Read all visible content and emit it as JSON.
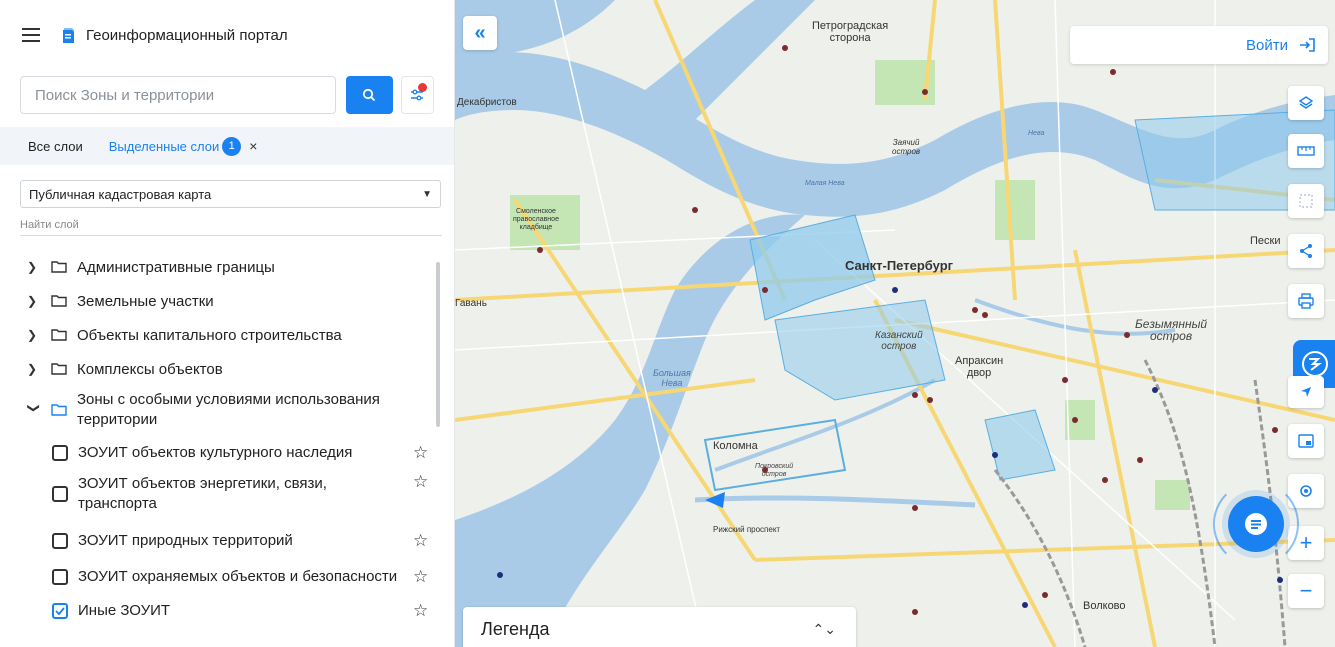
{
  "app": {
    "title": "Геоинформационный портал"
  },
  "search": {
    "placeholder": "Поиск Зоны и территории"
  },
  "tabs": {
    "all_label": "Все слои",
    "selected_label": "Выделенные слои",
    "selected_count": "1",
    "close": "×"
  },
  "basemap_select": {
    "value": "Публичная кадастровая карта"
  },
  "layer_search": {
    "placeholder": "Найти слой"
  },
  "tree": {
    "groups": [
      {
        "label": "Административные границы",
        "expanded": false
      },
      {
        "label": "Земельные участки",
        "expanded": false
      },
      {
        "label": "Объекты капитального строительства",
        "expanded": false
      },
      {
        "label": "Комплексы объектов",
        "expanded": false
      },
      {
        "label": "Зоны с особыми условиями использования территории",
        "expanded": true
      }
    ],
    "children": [
      {
        "label": "ЗОУИТ объектов культурного наследия",
        "checked": false
      },
      {
        "label": "ЗОУИТ объектов энергетики, связи, транспорта",
        "checked": false
      },
      {
        "label": "ЗОУИТ природных территорий",
        "checked": false
      },
      {
        "label": "ЗОУИТ охраняемых объектов и безопасности",
        "checked": false
      },
      {
        "label": "Иные ЗОУИТ",
        "checked": true
      }
    ]
  },
  "map": {
    "login_label": "Войти",
    "legend_label": "Легенда",
    "labels": {
      "petrogradskaya": "Петроградская\nсторона",
      "dekabristov": "Декабристов",
      "zayachiy": "Заячий\nостров",
      "smolenskoe": "Смоленское\nправославное\nкладбище",
      "spb": "Санкт-Петербург",
      "gavan": "Гавань",
      "kazansky": "Казанский\nостров",
      "apraksin": "Апраксин\nдвор",
      "bezymyanny": "Безымянный\nостров",
      "peski": "Пески",
      "bolshaya_neva": "Большая\nНева",
      "kolomna": "Коломна",
      "pokrovsky": "Покровский\nостров",
      "rizhsky": "Рижский проспект",
      "volkovo": "Волково",
      "malaya_neva": "Малая Нева",
      "neva": "Нева"
    }
  },
  "colors": {
    "accent": "#1a82f0",
    "water": "#a9cbe8",
    "park": "#c4e6b5",
    "road": "#f7d774",
    "zone": "#8fcbec"
  }
}
